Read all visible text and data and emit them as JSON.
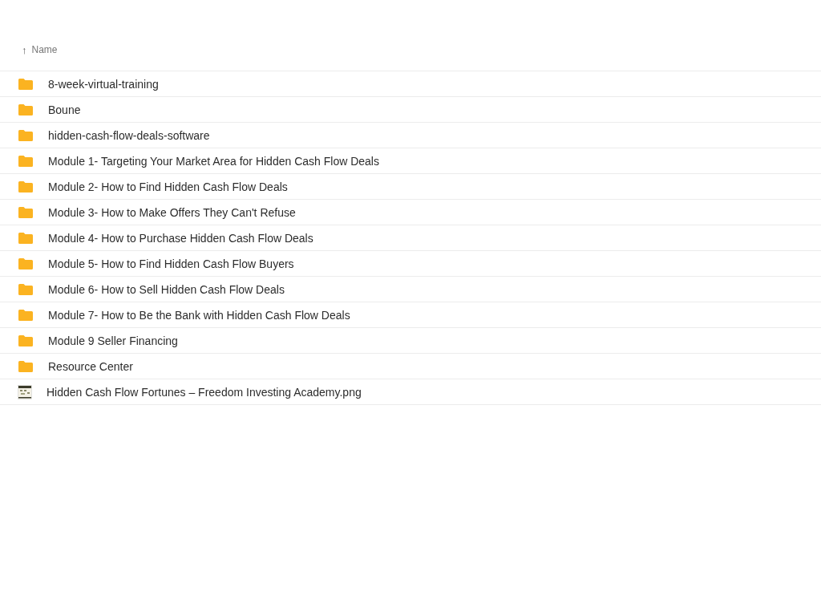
{
  "header": {
    "column": "Name",
    "sort_arrow": "↑"
  },
  "rows": [
    {
      "kind": "folder",
      "name": "8-week-virtual-training"
    },
    {
      "kind": "folder",
      "name": "Boune"
    },
    {
      "kind": "folder",
      "name": "hidden-cash-flow-deals-software"
    },
    {
      "kind": "folder",
      "name": "Module 1- Targeting Your Market Area for Hidden Cash Flow Deals"
    },
    {
      "kind": "folder",
      "name": "Module 2- How to Find Hidden Cash Flow Deals"
    },
    {
      "kind": "folder",
      "name": "Module 3- How to Make Offers They Can't Refuse"
    },
    {
      "kind": "folder",
      "name": "Module 4- How to Purchase Hidden Cash Flow Deals"
    },
    {
      "kind": "folder",
      "name": "Module 5- How to Find Hidden Cash Flow Buyers"
    },
    {
      "kind": "folder",
      "name": "Module 6- How to Sell Hidden Cash Flow Deals"
    },
    {
      "kind": "folder",
      "name": "Module 7- How to Be the Bank with Hidden Cash Flow Deals"
    },
    {
      "kind": "folder",
      "name": "Module 9 Seller Financing"
    },
    {
      "kind": "folder",
      "name": "Resource Center"
    },
    {
      "kind": "image",
      "name": "Hidden Cash Flow Fortunes – Freedom Investing Academy.png"
    }
  ]
}
